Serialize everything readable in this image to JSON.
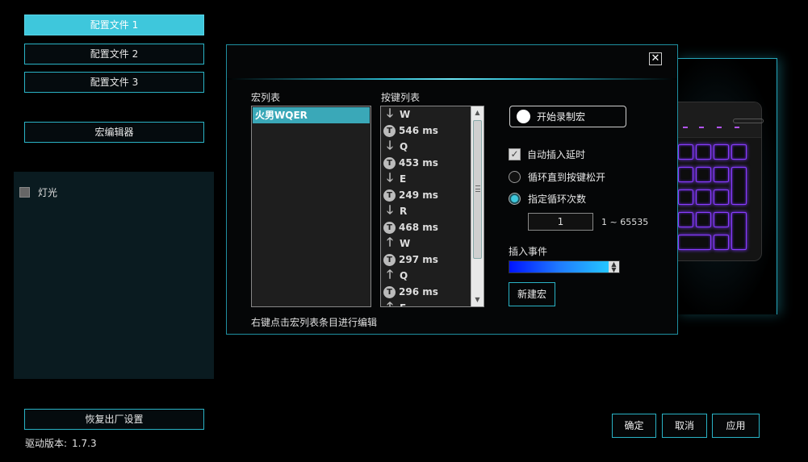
{
  "sidebar": {
    "profiles": [
      "配置文件 1",
      "配置文件 2",
      "配置文件 3"
    ],
    "macro_editor_label": "宏编辑器",
    "light_label": "灯光",
    "reset_label": "恢复出厂设置",
    "version_label": "驱动版本:",
    "version_value": "1.7.3"
  },
  "dialog": {
    "macro_list_title": "宏列表",
    "macros": [
      "火男WQER"
    ],
    "key_list_title": "按键列表",
    "key_events": [
      {
        "type": "down",
        "value": "W"
      },
      {
        "type": "delay",
        "value": "546 ms"
      },
      {
        "type": "down",
        "value": "Q"
      },
      {
        "type": "delay",
        "value": "453 ms"
      },
      {
        "type": "down",
        "value": "E"
      },
      {
        "type": "delay",
        "value": "249 ms"
      },
      {
        "type": "down",
        "value": "R"
      },
      {
        "type": "delay",
        "value": "468 ms"
      },
      {
        "type": "up",
        "value": "W"
      },
      {
        "type": "delay",
        "value": "297 ms"
      },
      {
        "type": "up",
        "value": "Q"
      },
      {
        "type": "delay",
        "value": "296 ms"
      },
      {
        "type": "up",
        "value": "E"
      }
    ],
    "hint": "右键点击宏列表条目进行编辑",
    "record_label": "开始录制宏",
    "auto_delay_label": "自动插入延时",
    "loop_until_release_label": "循环直到按键松开",
    "loop_count_label": "指定循环次数",
    "loop_count_value": "1",
    "loop_count_range": "1 ~ 65535",
    "insert_event_label": "插入事件",
    "new_macro_label": "新建宏"
  },
  "footer": {
    "ok_label": "确定",
    "cancel_label": "取消",
    "apply_label": "应用"
  },
  "colors": {
    "accent": "#3ec7dc",
    "border": "#2ab3c6",
    "key_glow": "#8a3cff"
  }
}
